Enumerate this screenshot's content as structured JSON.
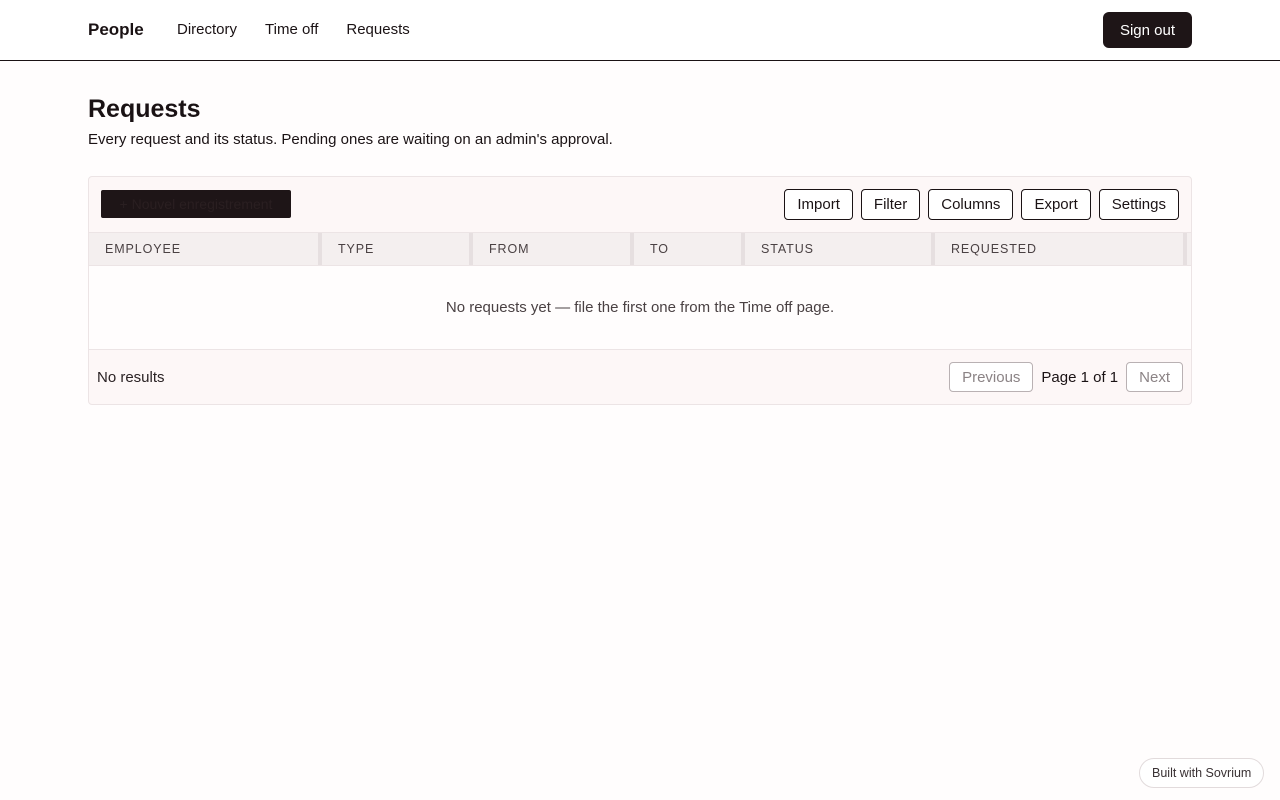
{
  "app": {
    "brand": "People"
  },
  "nav": {
    "items": [
      {
        "label": "Directory"
      },
      {
        "label": "Time off"
      },
      {
        "label": "Requests"
      }
    ],
    "signout_label": "Sign out"
  },
  "page": {
    "title": "Requests",
    "description": "Every request and its status. Pending ones are waiting on an admin's approval."
  },
  "toolbar": {
    "new_label": "+ Nouvel enregistrement",
    "buttons": [
      {
        "label": "Import"
      },
      {
        "label": "Filter"
      },
      {
        "label": "Columns"
      },
      {
        "label": "Export"
      },
      {
        "label": "Settings"
      }
    ]
  },
  "table": {
    "columns": [
      {
        "label": "EMPLOYEE"
      },
      {
        "label": "TYPE"
      },
      {
        "label": "FROM"
      },
      {
        "label": "TO"
      },
      {
        "label": "STATUS"
      },
      {
        "label": "REQUESTED"
      }
    ],
    "empty_message": "No requests yet — file the first one from the Time off page."
  },
  "pagination": {
    "results_text": "No results",
    "previous_label": "Previous",
    "page_info": "Page 1 of 1",
    "next_label": "Next"
  },
  "badge": {
    "label": "Built with Sovrium"
  }
}
